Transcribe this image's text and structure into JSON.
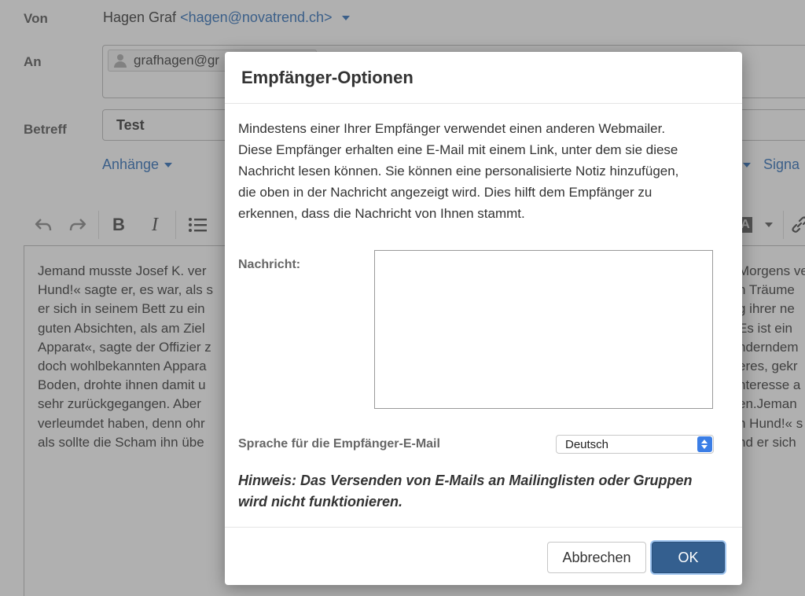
{
  "compose": {
    "from_label": "Von",
    "from_name": "Hagen Graf",
    "from_address": "<hagen@novatrend.ch>",
    "to_label": "An",
    "to_chip": "grafhagen@gr",
    "subject_label": "Betreff",
    "subject_value": "Test",
    "attachments_label": "Anhänge",
    "signature_label": "Signa",
    "toolbar": {
      "undo_icon": "undo-icon",
      "redo_icon": "redo-icon",
      "bold_label": "B",
      "italic_label": "I",
      "bullet_icon": "bulleted-list-icon",
      "text_color_label": "A",
      "link_icon": "link-icon"
    },
    "body_left": [
      "Jemand musste Josef K. ver",
      "Hund!« sagte er, es war, als s",
      "er sich in seinem Bett zu ein",
      "guten Absichten, als am Ziel",
      "Apparat«, sagte der Offizier z",
      "doch wohlbekannten Appara",
      "Boden, drohte ihnen damit u",
      "sehr zurückgegangen. Aber",
      "verleumdet haben, denn ohr",
      "als sollte die Scham ihn übe"
    ],
    "body_right": [
      "Morgens ve",
      "n Träume",
      "g ihrer ne",
      "Es ist ein",
      "nderndem",
      "eres, gekr",
      "nteresse a",
      "en.Jeman",
      "n Hund!« s",
      "nd er sich"
    ]
  },
  "modal": {
    "title": "Empfänger-Optionen",
    "intro_lines": [
      "Mindestens einer Ihrer Empfänger verwendet einen anderen Webmailer.",
      "Diese Empfänger erhalten eine E-Mail mit einem Link, unter dem sie diese",
      "Nachricht lesen können. Sie können eine personalisierte Notiz hinzufügen,",
      "die oben in der Nachricht angezeigt wird. Dies hilft dem Empfänger zu",
      "erkennen, dass die Nachricht von Ihnen stammt."
    ],
    "message_label": "Nachricht:",
    "message_value": "",
    "language_label": "Sprache für die Empfänger-E-Mail",
    "language_selected": "Deutsch",
    "hint_lines": [
      "Hinweis: Das Versenden von E-Mails an Mailinglisten oder Gruppen",
      "wird nicht funktionieren."
    ],
    "cancel_label": "Abbrechen",
    "ok_label": "OK"
  },
  "colors": {
    "link": "#2a6cb8",
    "primary_button": "#345f8f",
    "select_stepper": "#3b7ee6",
    "overlay": "rgba(80,80,80,0.45)"
  }
}
